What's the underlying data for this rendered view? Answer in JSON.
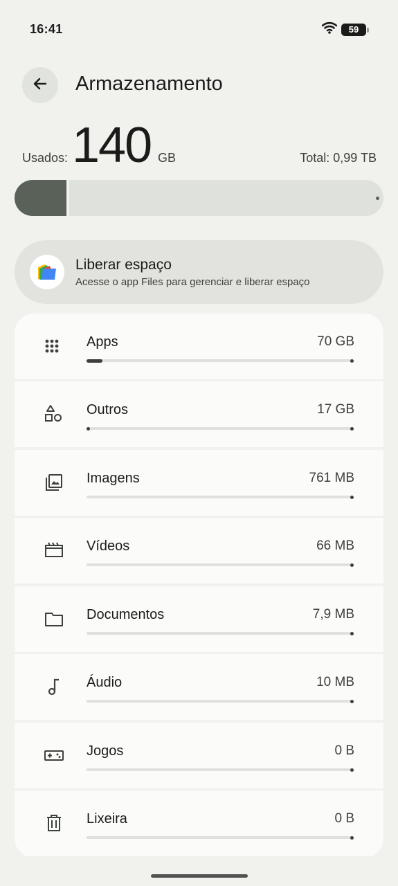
{
  "status_bar": {
    "time": "16:41",
    "battery": "59"
  },
  "header": {
    "title": "Armazenamento"
  },
  "summary": {
    "used_label": "Usados:",
    "used_value": "140",
    "used_unit": "GB",
    "total_label": "Total: 0,99 TB",
    "used_fraction": 0.14
  },
  "free_space": {
    "title": "Liberar espaço",
    "subtitle": "Acesse o app Files para gerenciar e liberar espaço",
    "icon": "files-app-icon"
  },
  "categories": [
    {
      "label": "Apps",
      "size": "70 GB",
      "icon": "apps-grid-icon",
      "fraction": 0.06
    },
    {
      "label": "Outros",
      "size": "17 GB",
      "icon": "shapes-icon",
      "fraction": 0.005
    },
    {
      "label": "Imagens",
      "size": "761 MB",
      "icon": "images-icon",
      "fraction": 0
    },
    {
      "label": "Vídeos",
      "size": "66 MB",
      "icon": "video-clapper-icon",
      "fraction": 0
    },
    {
      "label": "Documentos",
      "size": "7,9 MB",
      "icon": "folder-icon",
      "fraction": 0
    },
    {
      "label": "Áudio",
      "size": "10 MB",
      "icon": "music-note-icon",
      "fraction": 0
    },
    {
      "label": "Jogos",
      "size": "0 B",
      "icon": "gamepad-icon",
      "fraction": 0
    },
    {
      "label": "Lixeira",
      "size": "0 B",
      "icon": "trash-icon",
      "fraction": 0
    }
  ],
  "colors": {
    "background": "#f1f1ee",
    "bar_fill": "#596159",
    "bar_track": "#dfe1dc",
    "row_background": "#fbfbf9"
  }
}
